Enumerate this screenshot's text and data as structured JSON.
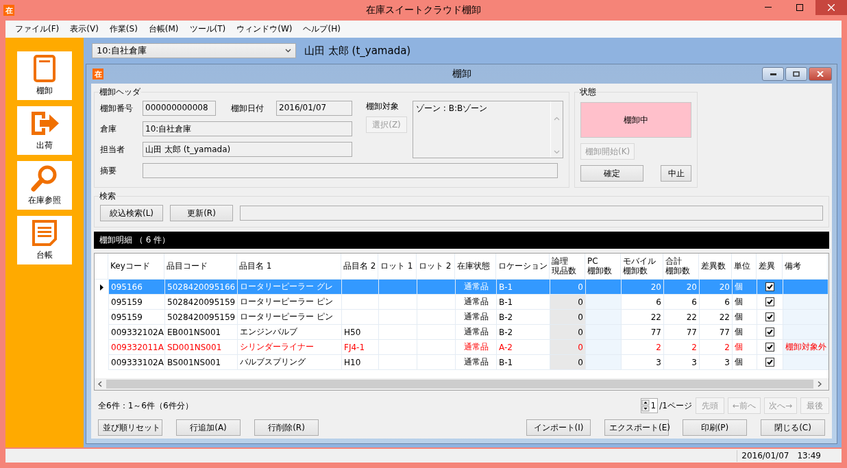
{
  "window": {
    "badge": "在",
    "title": "在庫スイートクラウド棚卸"
  },
  "menu": [
    "ファイル(F)",
    "表示(V)",
    "作業(S)",
    "台帳(M)",
    "ツール(T)",
    "ウィンドウ(W)",
    "ヘルプ(H)"
  ],
  "sidebar": [
    {
      "label": "棚卸"
    },
    {
      "label": "出荷"
    },
    {
      "label": "在庫参照"
    },
    {
      "label": "台帳"
    }
  ],
  "warehouse_select": {
    "value": "10:自社倉庫"
  },
  "user": "山田 太郎 (t_yamada)",
  "dialog": {
    "badge": "在",
    "title": "棚卸",
    "header": {
      "legend": "棚卸ヘッダ",
      "number": {
        "label": "棚卸番号",
        "value": "000000000008"
      },
      "date": {
        "label": "棚卸日付",
        "value": "2016/01/07"
      },
      "warehouse": {
        "label": "倉庫",
        "value": "10:自社倉庫"
      },
      "person": {
        "label": "担当者",
        "value": "山田 太郎 (t_yamada)"
      },
      "summary": {
        "label": "摘要"
      },
      "target": {
        "label": "棚卸対象",
        "value": "ゾーン : B:Bゾーン"
      },
      "select_button": {
        "label": "選択(Z)",
        "disabled": true
      }
    },
    "status": {
      "legend": "状態",
      "value": "棚卸中",
      "start_button": {
        "label": "棚卸開始(K)",
        "disabled": true
      },
      "buttons": [
        {
          "label": "確定",
          "disabled": false
        },
        {
          "label": "中止",
          "disabled": false
        }
      ]
    },
    "search": {
      "legend": "検索",
      "buttons": [
        "絞込検索(L)",
        "更新(R)"
      ]
    },
    "details": {
      "title": "棚卸明細 （ 6 件）",
      "columns": [
        {
          "lines": [
            "Keyコード"
          ],
          "kind": "text"
        },
        {
          "lines": [
            "品目コード"
          ],
          "kind": "text"
        },
        {
          "lines": [
            "品目名 1"
          ],
          "kind": "text"
        },
        {
          "lines": [
            "品目名 2"
          ],
          "kind": "text"
        },
        {
          "lines": [
            "ロット 1"
          ],
          "kind": "text"
        },
        {
          "lines": [
            "ロット 2"
          ],
          "kind": "text"
        },
        {
          "lines": [
            "在庫状態"
          ],
          "kind": "center"
        },
        {
          "lines": [
            "ロケーション"
          ],
          "kind": "text"
        },
        {
          "lines": [
            "論理",
            "現品数"
          ],
          "kind": "number"
        },
        {
          "lines": [
            "PC",
            "棚卸数"
          ],
          "kind": "number"
        },
        {
          "lines": [
            "モバイル",
            "棚卸数"
          ],
          "kind": "number"
        },
        {
          "lines": [
            "合計",
            "棚卸数"
          ],
          "kind": "number"
        },
        {
          "lines": [
            "差異数"
          ],
          "kind": "number"
        },
        {
          "lines": [
            "単位"
          ],
          "kind": "text"
        },
        {
          "lines": [
            "差異"
          ],
          "kind": "check"
        },
        {
          "lines": [
            "備考"
          ],
          "kind": "text"
        }
      ],
      "rows": [
        {
          "selected": true,
          "warning": false,
          "checked": true,
          "cells": [
            "095166",
            "5028420095166",
            "ロータリーピーラー グレ",
            "",
            "",
            "",
            "通常品",
            "B-1",
            "0",
            "",
            "20",
            "20",
            "20",
            "個",
            "",
            ""
          ]
        },
        {
          "selected": false,
          "warning": false,
          "checked": true,
          "cells": [
            "095159",
            "5028420095159",
            "ロータリーピーラー ピン",
            "",
            "",
            "",
            "通常品",
            "B-1",
            "0",
            "",
            "6",
            "6",
            "6",
            "個",
            "",
            ""
          ]
        },
        {
          "selected": false,
          "warning": false,
          "checked": true,
          "cells": [
            "095159",
            "5028420095159",
            "ロータリーピーラー ピン",
            "",
            "",
            "",
            "通常品",
            "B-2",
            "0",
            "",
            "22",
            "22",
            "22",
            "個",
            "",
            ""
          ]
        },
        {
          "selected": false,
          "warning": false,
          "checked": true,
          "cells": [
            "009332102A",
            "EB001NS001",
            "エンジンバルブ",
            "H50",
            "",
            "",
            "通常品",
            "B-2",
            "0",
            "",
            "77",
            "77",
            "77",
            "個",
            "",
            ""
          ]
        },
        {
          "selected": false,
          "warning": true,
          "checked": true,
          "cells": [
            "009332011A",
            "SD001NS001",
            "シリンダーライナー",
            "FJ4-1",
            "",
            "",
            "通常品",
            "A-2",
            "0",
            "",
            "2",
            "2",
            "2",
            "個",
            "",
            "棚卸対象外"
          ]
        },
        {
          "selected": false,
          "warning": false,
          "checked": true,
          "cells": [
            "009333102A",
            "BS001NS001",
            "バルブスプリング",
            "H10",
            "",
            "",
            "通常品",
            "B-1",
            "0",
            "",
            "3",
            "3",
            "3",
            "個",
            "",
            ""
          ]
        }
      ]
    },
    "pager": {
      "summary": "全6件：1～6件（6件分）",
      "page": "1",
      "pages": "/1ページ",
      "buttons": [
        {
          "label": "先頭",
          "disabled": true
        },
        {
          "label": "←前へ",
          "disabled": true
        },
        {
          "label": "次へ→",
          "disabled": true
        },
        {
          "label": "最後",
          "disabled": true
        }
      ]
    },
    "left_buttons": [
      "並び順リセット",
      "行追加(A)",
      "行削除(R)"
    ],
    "right_buttons": [
      "インポート(I)",
      "エクスポート(E)",
      "印刷(P)",
      "閉じる(C)"
    ]
  },
  "status_bar": {
    "datetime": "2016/01/07　13:49"
  }
}
